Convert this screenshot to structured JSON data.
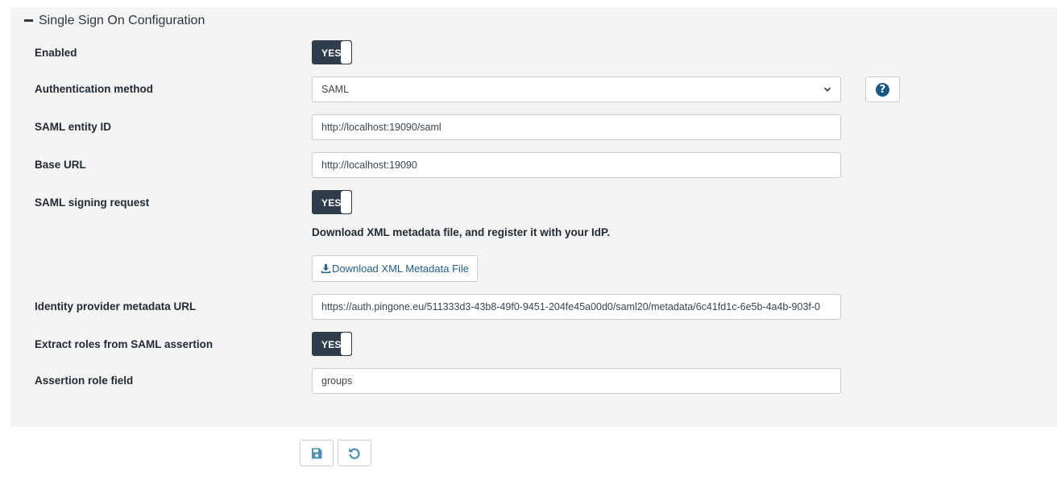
{
  "panel": {
    "title": "Single Sign On Configuration"
  },
  "rows": {
    "enabled": {
      "label": "Enabled",
      "toggle": "YES"
    },
    "auth_method": {
      "label": "Authentication method",
      "selected": "SAML"
    },
    "entity_id": {
      "label": "SAML entity ID",
      "value": "http://localhost:19090/saml"
    },
    "base_url": {
      "label": "Base URL",
      "value": "http://localhost:19090"
    },
    "signing_request": {
      "label": "SAML signing request",
      "toggle": "YES"
    },
    "metadata_info": {
      "text": "Download XML metadata file, and register it with your IdP."
    },
    "download": {
      "label": "Download XML Metadata File"
    },
    "idp_metadata_url": {
      "label": "Identity provider metadata URL",
      "value": "https://auth.pingone.eu/511333d3-43b8-49f0-9451-204fe45a00d0/saml20/metadata/6c41fd1c-6e5b-4a4b-903f-0"
    },
    "extract_roles": {
      "label": "Extract roles from SAML assertion",
      "toggle": "YES"
    },
    "role_field": {
      "label": "Assertion role field",
      "value": "groups"
    }
  },
  "icons": {
    "collapse": "minus-icon",
    "help": "question-circle-icon",
    "download": "download-icon",
    "save": "save-icon",
    "reset": "undo-icon",
    "select": "chevron-down-icon"
  },
  "colors": {
    "toggle_on": "#2f3d4a",
    "link": "#1f5f8b",
    "help": "#155a8a",
    "action_icon": "#4a90b8",
    "panel_bg": "#f4f4f4"
  }
}
